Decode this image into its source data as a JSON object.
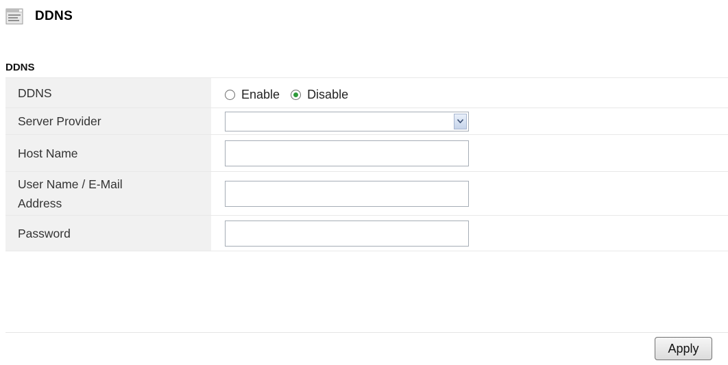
{
  "header": {
    "title": "DDNS",
    "icon": "settings-page-icon"
  },
  "section": {
    "title": "DDNS"
  },
  "form": {
    "ddns": {
      "label": "DDNS",
      "options": [
        {
          "label": "Enable",
          "selected": false
        },
        {
          "label": "Disable",
          "selected": true
        }
      ]
    },
    "server_provider": {
      "label": "Server Provider",
      "value": ""
    },
    "host_name": {
      "label": "Host Name",
      "value": ""
    },
    "user_name": {
      "label_line1": "User Name / E-Mail",
      "label_line2": "Address",
      "value": ""
    },
    "password": {
      "label": "Password",
      "value": ""
    }
  },
  "footer": {
    "apply_label": "Apply"
  },
  "colors": {
    "label_background": "#f1f1f1",
    "radio_selected": "#2e9a3a",
    "input_border": "#a5acb5"
  }
}
